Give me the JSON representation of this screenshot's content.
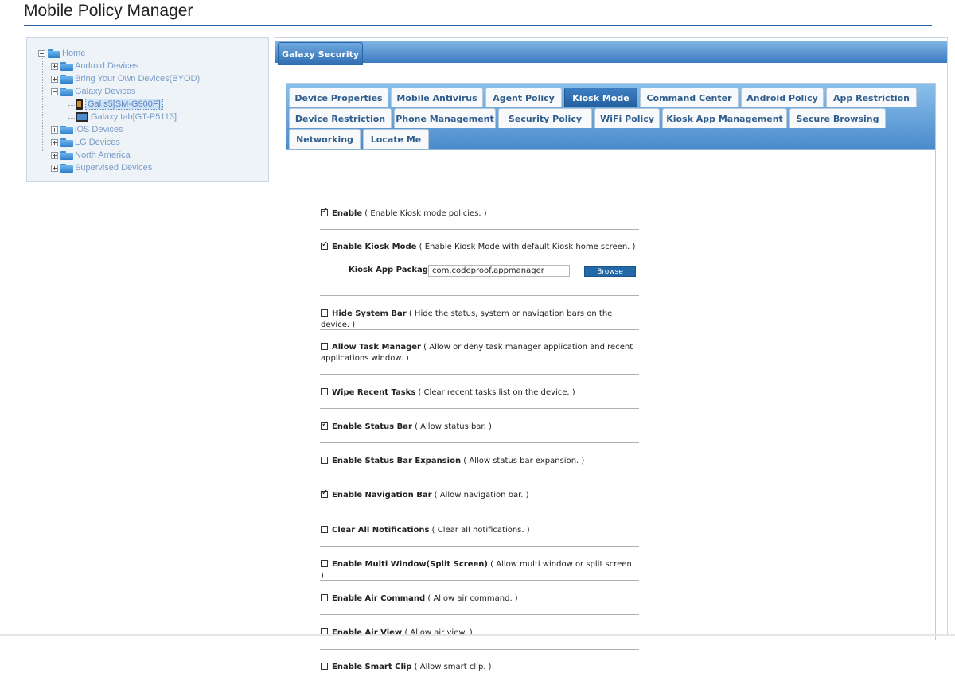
{
  "app": {
    "title": "Mobile Policy Manager"
  },
  "tree": {
    "home": "Home",
    "android": "Android Devices",
    "byod": "Bring Your Own Devices(BYOD)",
    "galaxy": "Galaxy Devices",
    "gal_s5": "Gal s5[SM-G900F]",
    "galaxy_tab": "Galaxy tab[GT-P5113]",
    "ios": "iOS Devices",
    "lg": "LG Devices",
    "north_america": "North America",
    "supervised": "Supervised Devices"
  },
  "panel": {
    "section_tab": "Galaxy Security"
  },
  "tabs": {
    "device_properties": "Device Properties",
    "mobile_antivirus": "Mobile Antivirus",
    "agent_policy": "Agent Policy",
    "kiosk_mode": "Kiosk Mode",
    "command_center": "Command Center",
    "android_policy": "Android Policy",
    "app_restriction": "App Restriction",
    "device_restriction": "Device Restriction",
    "phone_management": "Phone Management",
    "security_policy": "Security Policy",
    "wifi_policy": "WiFi Policy",
    "kiosk_app_management": "Kiosk App Management",
    "secure_browsing": "Secure Browsing",
    "networking": "Networking",
    "locate_me": "Locate Me"
  },
  "policies": {
    "enable": {
      "name": "Enable",
      "desc": " ( Enable Kiosk mode policies. )",
      "checked": true
    },
    "enable_kiosk_mode": {
      "name": "Enable Kiosk Mode",
      "desc": " ( Enable Kiosk Mode with default Kiosk home screen. )",
      "checked": true
    },
    "hide_system_bar": {
      "name": "Hide System Bar",
      "desc": " ( Hide the status, system or navigation bars on the device. )",
      "checked": false
    },
    "allow_task_manager": {
      "name": "Allow Task Manager",
      "desc": " ( Allow or deny task manager application and recent applications window. )",
      "checked": false
    },
    "wipe_recent_tasks": {
      "name": "Wipe Recent Tasks",
      "desc": " ( Clear recent tasks list on the device. )",
      "checked": false
    },
    "enable_status_bar": {
      "name": "Enable Status Bar",
      "desc": " ( Allow status bar. )",
      "checked": true
    },
    "enable_status_bar_expansion": {
      "name": "Enable Status Bar Expansion",
      "desc": " ( Allow status bar expansion. )",
      "checked": false
    },
    "enable_navigation_bar": {
      "name": "Enable Navigation Bar",
      "desc": " ( Allow navigation bar. )",
      "checked": true
    },
    "clear_all_notifications": {
      "name": "Clear All Notifications",
      "desc": " ( Clear all notifications. )",
      "checked": false
    },
    "enable_multi_window": {
      "name": "Enable Multi Window(Split Screen)",
      "desc": " ( Allow multi window or split screen. )",
      "checked": false
    },
    "enable_air_command": {
      "name": "Enable Air Command",
      "desc": " ( Allow air command. )",
      "checked": false
    },
    "enable_air_view": {
      "name": "Enable Air View",
      "desc": " ( Allow air view. )",
      "checked": false
    },
    "enable_smart_clip": {
      "name": "Enable Smart Clip",
      "desc": " ( Allow smart clip. )",
      "checked": false
    }
  },
  "kiosk_app": {
    "label": "Kiosk App Package",
    "value": "com.codeproof.appmanager",
    "browse_label": "Browse"
  }
}
